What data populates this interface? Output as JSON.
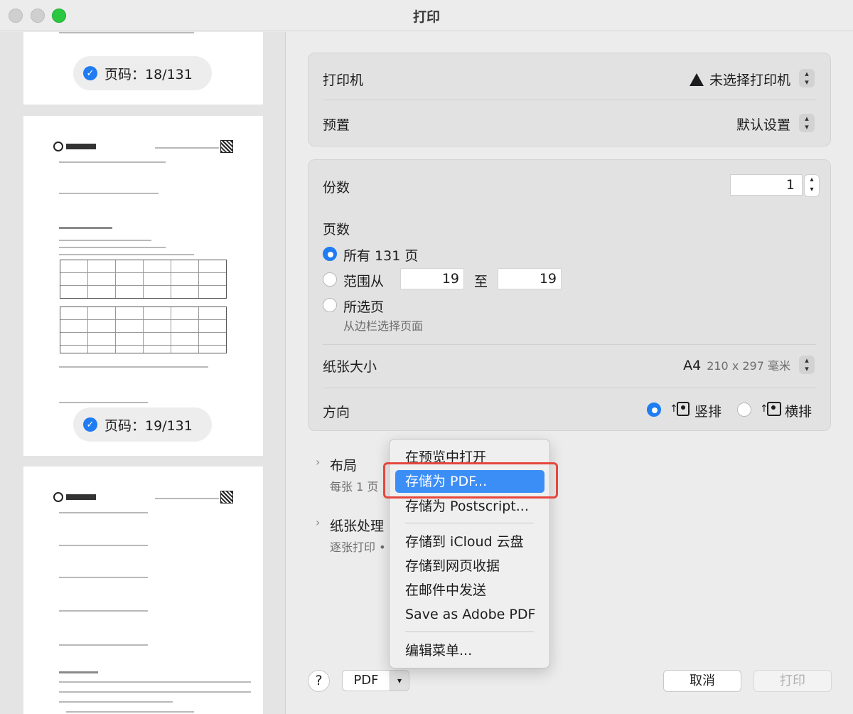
{
  "window": {
    "title": "打印"
  },
  "sidebar": {
    "pages": [
      {
        "label": "页码：18/131",
        "checked": true
      },
      {
        "label": "页码：19/131",
        "checked": true
      }
    ]
  },
  "printer_section": {
    "printer_label": "打印机",
    "printer_value": "未选择打印机",
    "preset_label": "预置",
    "preset_value": "默认设置"
  },
  "options_section": {
    "copies_label": "份数",
    "copies_value": "1",
    "pages_label": "页数",
    "all_pages_label": "所有 131 页",
    "range_label": "范围从",
    "range_from": "19",
    "range_to_label": "至",
    "range_to": "19",
    "selected_label": "所选页",
    "selected_sub": "从边栏选择页面",
    "page_range_selected": "all",
    "paper_label": "纸张大小",
    "paper_value": "A4",
    "paper_dims": "210 x 297 毫米",
    "orientation_label": "方向",
    "portrait_label": "竖排",
    "landscape_label": "横排",
    "orientation_selected": "portrait"
  },
  "sections": {
    "layout_title": "布局",
    "layout_sub": "每张 1 页",
    "paper_handling_title": "纸张处理",
    "paper_handling_sub": "逐张打印 •"
  },
  "pdf_menu": {
    "items": [
      "在预览中打开",
      "存储为 PDF...",
      "存储为 Postscript...",
      "存储到 iCloud 云盘",
      "存储到网页收据",
      "在邮件中发送",
      "Save as Adobe PDF",
      "编辑菜单..."
    ],
    "highlighted_index": 1
  },
  "footer": {
    "help_label": "?",
    "pdf_label": "PDF",
    "cancel_label": "取消",
    "print_label": "打印"
  },
  "colors": {
    "accent": "#1f7cf2",
    "menu_highlight": "#3c8ef7",
    "focus_ring": "#e5473e"
  }
}
